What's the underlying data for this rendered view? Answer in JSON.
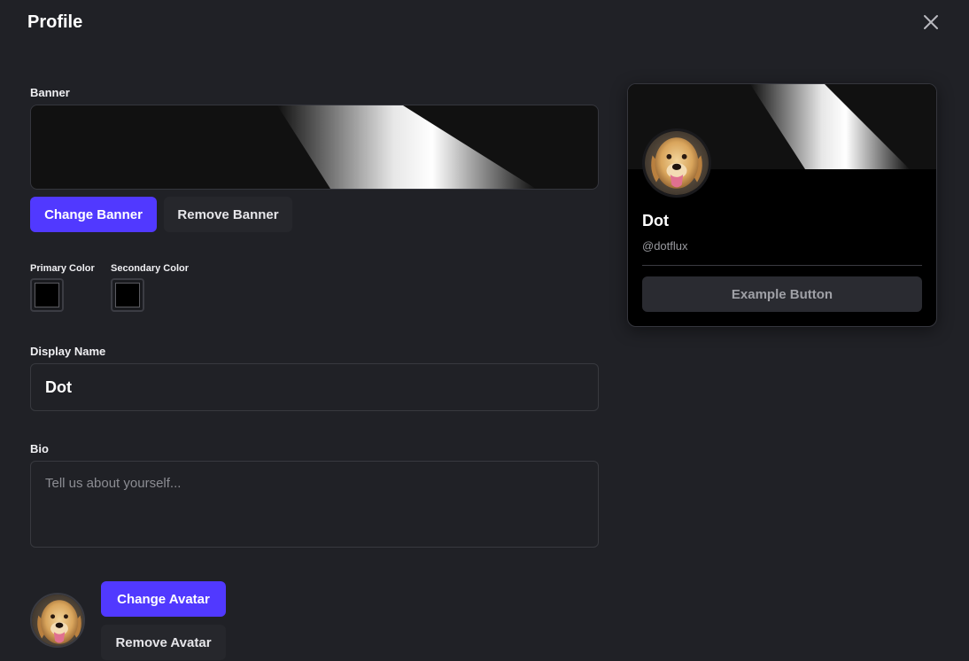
{
  "dialog": {
    "title": "Profile"
  },
  "banner": {
    "label": "Banner",
    "change_label": "Change Banner",
    "remove_label": "Remove Banner"
  },
  "colors": {
    "primary_label": "Primary Color",
    "secondary_label": "Secondary Color",
    "primary_value": "#000000",
    "secondary_value": "#000000"
  },
  "display_name": {
    "label": "Display Name",
    "value": "Dot"
  },
  "bio": {
    "label": "Bio",
    "placeholder": "Tell us about yourself..."
  },
  "avatar": {
    "change_label": "Change Avatar",
    "remove_label": "Remove Avatar"
  },
  "preview": {
    "name": "Dot",
    "handle": "@dotflux",
    "button_label": "Example Button"
  },
  "theme": {
    "accent": "#5139ff",
    "background": "#202126",
    "card_background": "#000000"
  }
}
